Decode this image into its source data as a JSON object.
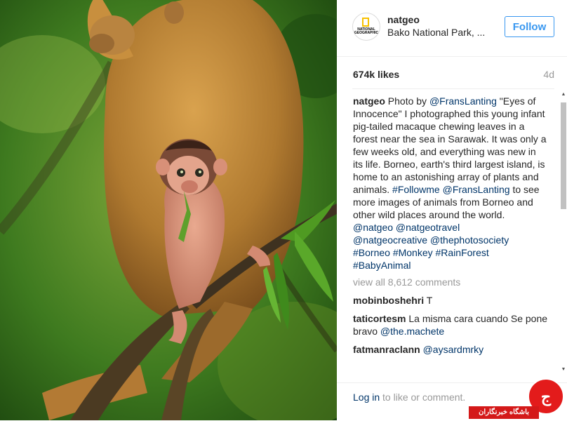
{
  "post": {
    "username": "natgeo",
    "location": "Bako National Park, ...",
    "follow_label": "Follow",
    "likes": "674k likes",
    "age": "4d",
    "logo_text": [
      "NATIONAL",
      "GEOGRAPHIC"
    ]
  },
  "caption": {
    "username": "natgeo",
    "text_1": "Photo by ",
    "mention_1": "@FransLanting",
    "text_2": " \"Eyes of Innocence\" I photographed this young infant pig-tailed macaque chewing leaves in a forest near the sea in Sarawak. It was only a few weeks old, and everything was new in its life. Borneo, earth's third largest island, is home to an astonishing array of plants and animals. ",
    "tag_1": "#Followme",
    "mention_2": "@FransLanting",
    "text_3": " to see more images of animals from Borneo and other wild places around the world.",
    "tag_line_1": "@natgeo @natgeotravel",
    "tag_line_2": "@natgeocreative @thephotosociety",
    "tag_line_3": "#Borneo #Monkey #RainForest",
    "tag_line_4": "#BabyAnimal"
  },
  "view_all": "view all 8,612 comments",
  "comments": [
    {
      "user": "mobinboshehri",
      "text": "T",
      "mention": ""
    },
    {
      "user": "taticortesm",
      "text": "La misma cara cuando Se pone bravo ",
      "mention": "@the.machete"
    },
    {
      "user": "fatmanraclann",
      "text": "",
      "mention": "@aysardmrky"
    }
  ],
  "footer": {
    "login_link": "Log in",
    "login_rest": " to like or comment."
  },
  "watermark": {
    "text": "باشگاه خبرنگاران",
    "symbol": "ج"
  },
  "colors": {
    "accent": "#3897f0",
    "link": "#003569",
    "muted": "#999999",
    "watermark_red": "#d41919"
  }
}
